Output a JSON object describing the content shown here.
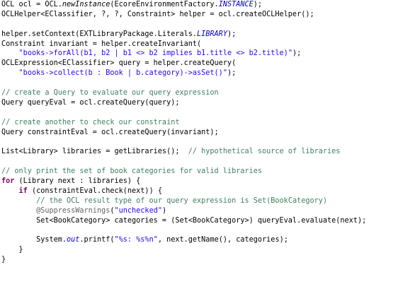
{
  "editor": {
    "language": "java",
    "colors": {
      "keyword": "#7f0055",
      "string": "#2a00ff",
      "comment": "#3f7f5f",
      "annotation": "#646464",
      "static_field": "#0000c0",
      "text": "#000000",
      "background": "#ffffff"
    },
    "lines": [
      [
        {
          "t": "p",
          "v": "OCL ocl = OCL."
        },
        {
          "t": "si",
          "v": "newInstance"
        },
        {
          "t": "p",
          "v": "(EcoreEnvironmentFactory."
        },
        {
          "t": "sf",
          "v": "INSTANCE"
        },
        {
          "t": "p",
          "v": ");"
        }
      ],
      [
        {
          "t": "p",
          "v": "OCLHelper<EClassifier, ?, ?, Constraint> helper = ocl.createOCLHelper();"
        }
      ],
      [],
      [
        {
          "t": "p",
          "v": "helper.setContext(EXTLibraryPackage.Literals."
        },
        {
          "t": "sf",
          "v": "LIBRARY"
        },
        {
          "t": "p",
          "v": ");"
        }
      ],
      [
        {
          "t": "p",
          "v": "Constraint invariant = helper.createInvariant("
        }
      ],
      [
        {
          "t": "p",
          "v": "    "
        },
        {
          "t": "str",
          "v": "\"books->forAll(b1, b2 | b1 <> b2 implies b1.title <> b2.title)\""
        },
        {
          "t": "p",
          "v": ");"
        }
      ],
      [
        {
          "t": "p",
          "v": "OCLExpression<EClassifier> query = helper.createQuery("
        }
      ],
      [
        {
          "t": "p",
          "v": "    "
        },
        {
          "t": "str",
          "v": "\"books->collect(b : Book | b.category)->asSet()\""
        },
        {
          "t": "p",
          "v": ");"
        }
      ],
      [],
      [
        {
          "t": "com",
          "v": "// create a Query to evaluate our query expression"
        }
      ],
      [
        {
          "t": "p",
          "v": "Query queryEval = ocl.createQuery(query);"
        }
      ],
      [],
      [
        {
          "t": "com",
          "v": "// create another to check our constraint"
        }
      ],
      [
        {
          "t": "p",
          "v": "Query constraintEval = ocl.createQuery(invariant);"
        }
      ],
      [],
      [
        {
          "t": "p",
          "v": "List<Library> libraries = getLibraries();  "
        },
        {
          "t": "com",
          "v": "// hypothetical source of libraries"
        }
      ],
      [],
      [
        {
          "t": "com",
          "v": "// only print the set of book categories for valid libraries"
        }
      ],
      [
        {
          "t": "kw",
          "v": "for"
        },
        {
          "t": "p",
          "v": " (Library next : libraries) {"
        }
      ],
      [
        {
          "t": "p",
          "v": "    "
        },
        {
          "t": "kw",
          "v": "if"
        },
        {
          "t": "p",
          "v": " (constraintEval.check(next)) {"
        }
      ],
      [
        {
          "t": "p",
          "v": "        "
        },
        {
          "t": "com",
          "v": "// the OCL result type of our query expression is Set(BookCategory)"
        }
      ],
      [
        {
          "t": "p",
          "v": "        "
        },
        {
          "t": "ann",
          "v": "@SuppressWarnings"
        },
        {
          "t": "p",
          "v": "("
        },
        {
          "t": "str",
          "v": "\"unchecked\""
        },
        {
          "t": "p",
          "v": ")"
        }
      ],
      [
        {
          "t": "p",
          "v": "        Set<BookCategory> categories = (Set<BookCategory>) queryEval.evaluate(next);"
        }
      ],
      [],
      [
        {
          "t": "p",
          "v": "        System."
        },
        {
          "t": "sfi",
          "v": "out"
        },
        {
          "t": "p",
          "v": ".printf("
        },
        {
          "t": "str",
          "v": "\"%s: %s%n\""
        },
        {
          "t": "p",
          "v": ", next.getName(), categories);"
        }
      ],
      [
        {
          "t": "p",
          "v": "    }"
        }
      ],
      [
        {
          "t": "p",
          "v": "}"
        }
      ]
    ]
  }
}
